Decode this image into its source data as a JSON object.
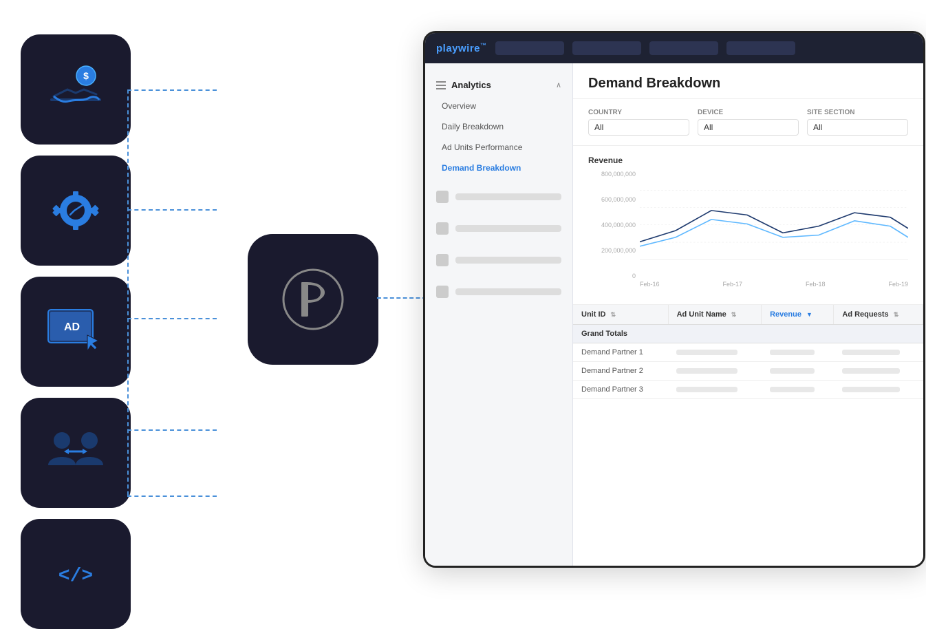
{
  "browser": {
    "logo": "playwire",
    "logo_trademark": "™"
  },
  "sidebar": {
    "analytics_label": "Analytics",
    "overview_label": "Overview",
    "daily_breakdown_label": "Daily Breakdown",
    "ad_units_label": "Ad Units Performance",
    "demand_breakdown_label": "Demand Breakdown"
  },
  "content": {
    "title": "Demand Breakdown",
    "filters": [
      {
        "label": "Country",
        "value": "All"
      },
      {
        "label": "Device",
        "value": "All"
      },
      {
        "label": "Site Section",
        "value": "All"
      }
    ],
    "chart": {
      "title": "Revenue",
      "y_labels": [
        "0",
        "200,000,000",
        "400,000,000",
        "600,000,000",
        "800,000,000"
      ],
      "x_labels": [
        "Feb-16",
        "Feb-17",
        "Feb-18",
        "Feb-19"
      ],
      "line1_points": "0,160 80,110 160,60 240,70 320,120 400,100 480,65 560,75 640,100 720,110",
      "line2_points": "0,140 80,120 160,75 240,85 320,115 400,110 480,80 560,90 640,110 720,125"
    },
    "table": {
      "columns": [
        {
          "label": "Unit ID",
          "sortable": true
        },
        {
          "label": "Ad Unit Name",
          "sortable": true
        },
        {
          "label": "Revenue",
          "sortable": true,
          "active": true
        },
        {
          "label": "Ad Requests",
          "sortable": true
        }
      ],
      "grand_totals_label": "Grand Totals",
      "rows": [
        {
          "col1": "Demand Partner 1"
        },
        {
          "col1": "Demand Partner 2"
        },
        {
          "col1": "Demand Partner 3"
        }
      ]
    }
  },
  "icons": [
    {
      "id": "revenue-icon",
      "symbol": "💰",
      "type": "revenue"
    },
    {
      "id": "settings-icon",
      "symbol": "⚙",
      "type": "settings"
    },
    {
      "id": "ad-icon",
      "symbol": "AD",
      "type": "ad"
    },
    {
      "id": "users-icon",
      "symbol": "👥",
      "type": "users"
    },
    {
      "id": "code-icon",
      "symbol": "</>",
      "type": "code"
    }
  ]
}
